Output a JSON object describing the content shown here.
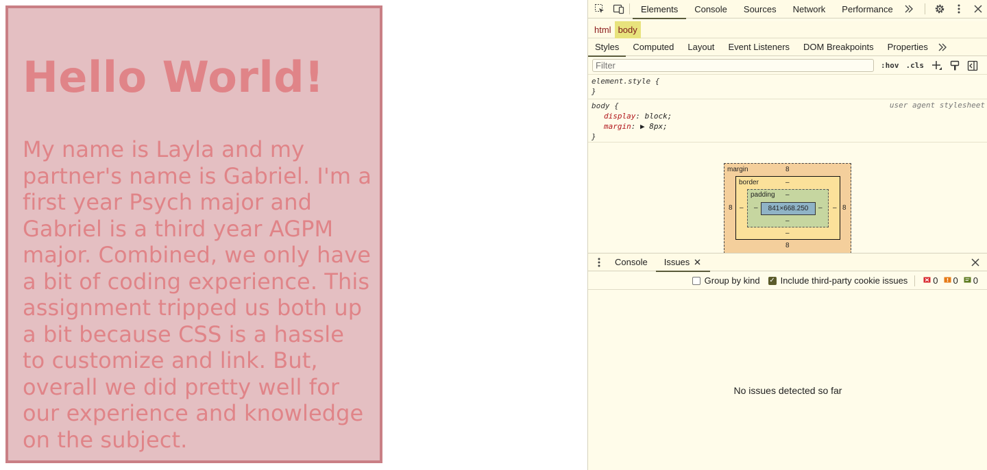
{
  "page": {
    "heading": "Hello World!",
    "paragraph": "My name is Layla and my partner's name is Gabriel. I'm a first year Psych major and Gabriel is a third year AGPM major. Combined, we only have a bit of coding experience. This assignment tripped us both up a bit because CSS is a hassle to customize and link. But, overall we did pretty well for our experience and knowledge on the subject."
  },
  "devtools": {
    "top_tabs": [
      "Elements",
      "Console",
      "Sources",
      "Network",
      "Performance"
    ],
    "active_top_tab": "Elements",
    "more_tabs": "»",
    "breadcrumbs": [
      "html",
      "body"
    ],
    "sub_tabs": [
      "Styles",
      "Computed",
      "Layout",
      "Event Listeners",
      "DOM Breakpoints",
      "Properties"
    ],
    "active_sub_tab": "Styles",
    "filter_placeholder": "Filter",
    "hov": ":hov",
    "cls": ".cls",
    "rule_element": {
      "selector": "element.style {",
      "close": "}"
    },
    "rule_body": {
      "selector": "body {",
      "source": "user agent stylesheet",
      "props": [
        {
          "name": "display",
          "value": "block;"
        },
        {
          "name": "margin",
          "value": "▶ 8px;"
        }
      ],
      "close": "}"
    },
    "box_model": {
      "margin_label": "margin",
      "margin_top": "8",
      "margin_bottom": "8",
      "margin_left": "8",
      "margin_right": "8",
      "border_label": "border",
      "border_top": "–",
      "border_bottom": "–",
      "border_left": "–",
      "border_right": "–",
      "padding_label": "padding",
      "padding_top": "–",
      "padding_bottom": "–",
      "padding_left": "–",
      "padding_right": "–",
      "content_size": "841×668.250"
    },
    "drawer_tabs": [
      "Console",
      "Issues"
    ],
    "active_drawer_tab": "Issues",
    "group_by_kind": "Group by kind",
    "include_third_party": "Include third-party cookie issues",
    "counts": {
      "errors": "0",
      "warnings": "0",
      "info": "0"
    },
    "empty_message": "No issues detected so far"
  },
  "colors": {
    "card_bg": "#e4bfc2",
    "card_border": "#c97f85",
    "text": "#e08488",
    "devtools_bg": "#fffcea"
  }
}
